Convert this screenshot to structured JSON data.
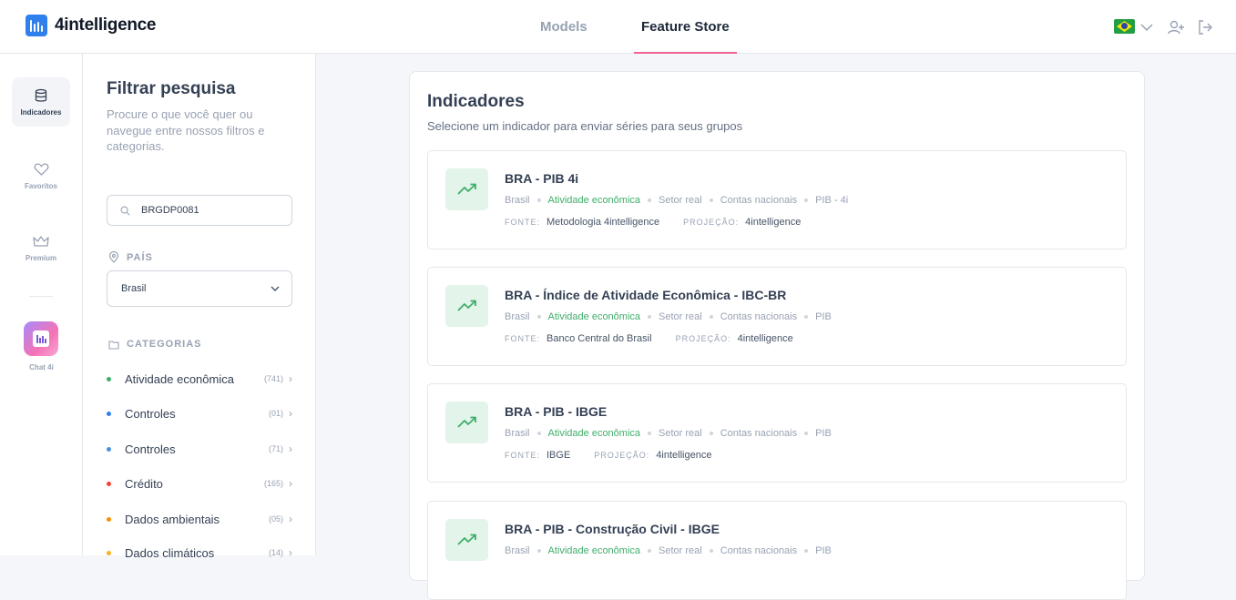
{
  "header": {
    "logo_text": "4intelligence",
    "nav": [
      {
        "label": "Models"
      },
      {
        "label": "Feature Store"
      }
    ],
    "active_tab": "Feature Store",
    "accent_color": "#f06292",
    "language": "pt-BR",
    "icons": [
      "brazil-flag-icon",
      "chevron-down-icon",
      "add-user-icon",
      "logout-icon"
    ]
  },
  "rail": {
    "items": [
      {
        "label": "Indicadores",
        "icon": "database-icon",
        "active": true
      },
      {
        "label": "Favoritos",
        "icon": "heart-icon"
      },
      {
        "label": "Premium",
        "icon": "crown-icon"
      }
    ],
    "chat_label": "Chat 4i"
  },
  "filters": {
    "title": "Filtrar pesquisa",
    "description": "Procure o que você quer ou navegue entre nossos filtros e categorias.",
    "search": {
      "value": "BRGDP0081",
      "placeholder": ""
    },
    "country": {
      "label": "PAÍS",
      "selected": "Brasil"
    },
    "categories_label": "CATEGORIAS",
    "categories": [
      {
        "name": "Atividade econômica",
        "count": "(741)",
        "color": "#3fae6a"
      },
      {
        "name": "Controles",
        "count": "(01)",
        "color": "#2f80ed"
      },
      {
        "name": "Controles",
        "count": "(71)",
        "color": "#4a90e2"
      },
      {
        "name": "Crédito",
        "count": "(165)",
        "color": "#f04438"
      },
      {
        "name": "Dados ambientais",
        "count": "(05)",
        "color": "#f79009"
      },
      {
        "name": "Dados climáticos",
        "count": "(14)",
        "color": "#fdb022"
      }
    ]
  },
  "main": {
    "title": "Indicadores",
    "subtitle": "Selecione um indicador para enviar séries para seus grupos",
    "source_key": "FONTE:",
    "projection_key": "PROJEÇÃO:",
    "cards": [
      {
        "title": "BRA - PIB 4i",
        "tags": [
          "Brasil",
          "Atividade econômica",
          "Setor real",
          "Contas nacionais",
          "PIB - 4i"
        ],
        "source": "Metodologia 4intelligence",
        "projection": "4intelligence"
      },
      {
        "title": "BRA - Índice de Atividade Econômica - IBC-BR",
        "tags": [
          "Brasil",
          "Atividade econômica",
          "Setor real",
          "Contas nacionais",
          "PIB"
        ],
        "source": "Banco Central do Brasil",
        "projection": "4intelligence"
      },
      {
        "title": "BRA - PIB - IBGE",
        "tags": [
          "Brasil",
          "Atividade econômica",
          "Setor real",
          "Contas nacionais",
          "PIB"
        ],
        "source": "IBGE",
        "projection": "4intelligence"
      },
      {
        "title": "BRA - PIB - Construção Civil - IBGE",
        "tags": [
          "Brasil",
          "Atividade econômica",
          "Setor real",
          "Contas nacionais",
          "PIB"
        ],
        "source": "",
        "projection": ""
      }
    ]
  }
}
